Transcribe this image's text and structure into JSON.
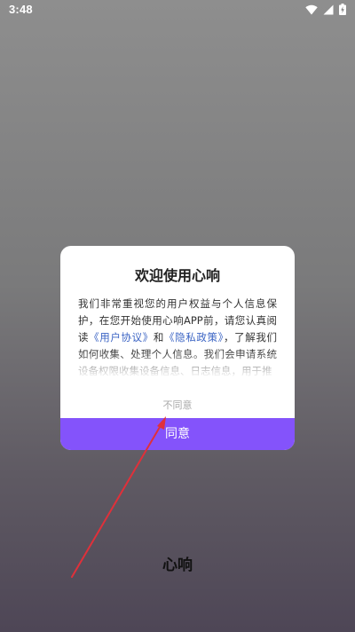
{
  "status_bar": {
    "time": "3:48",
    "icons": [
      "wifi-icon",
      "signal-icon",
      "battery-charging-icon"
    ]
  },
  "dialog": {
    "title": "欢迎使用心响",
    "body_segments": [
      {
        "text": "我们非常重视您的用户权益与个人信息保护，在您开始使用心响APP前，请您认真阅读",
        "link": false
      },
      {
        "text": "《用户协议》",
        "link": true
      },
      {
        "text": "和",
        "link": false
      },
      {
        "text": "《隐私政策》",
        "link": true
      },
      {
        "text": "，了解我们如何收集、处理个人信息。我们会申请系统设备权限收集设备信息、日志信息，用于推",
        "link": false
      }
    ],
    "disagree_label": "不同意",
    "agree_label": "同意"
  },
  "app_name": "心响",
  "colors": {
    "accent": "#8453fb",
    "link": "#3b64c4",
    "annotation_arrow": "#e0303a"
  }
}
